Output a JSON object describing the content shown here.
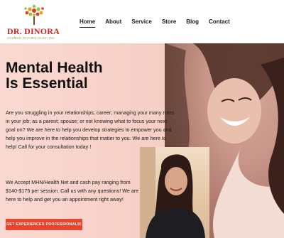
{
  "brand": {
    "name": "DR. DINORA",
    "subtitle": "GUZMAN PSYCHOLOGIST, INC."
  },
  "nav": {
    "items": [
      {
        "label": "Home",
        "active": true
      },
      {
        "label": "About",
        "active": false
      },
      {
        "label": "Service",
        "active": false
      },
      {
        "label": "Store",
        "active": false
      },
      {
        "label": "Blog",
        "active": false
      },
      {
        "label": "Contact",
        "active": false
      }
    ]
  },
  "hero": {
    "title_line1": "Mental Health",
    "title_line2": "Is Essential",
    "paragraph1": "Are you struggling in your relationships; career; managing your many roles in your job; as a parent; spouse; or not knowing what to focus your next goal on?  We are here to help you develop strategies to empower you and help you improve in the relationships that matter to you.  We are here to help!  Call for your consultation today !",
    "paragraph2": "We Accept MHN/Health Net and cash pay ranging from $140-$175 per session.   Call us with any questions! We are here to help and get you an appointment right away!",
    "cta_label": "GET EXPERIENCED PROFESSIONALS!"
  },
  "colors": {
    "brand_red": "#d2231f",
    "brand_green": "#7a9a3a",
    "hero_bg": "#f8d6ce",
    "cta": "#e8442e"
  }
}
